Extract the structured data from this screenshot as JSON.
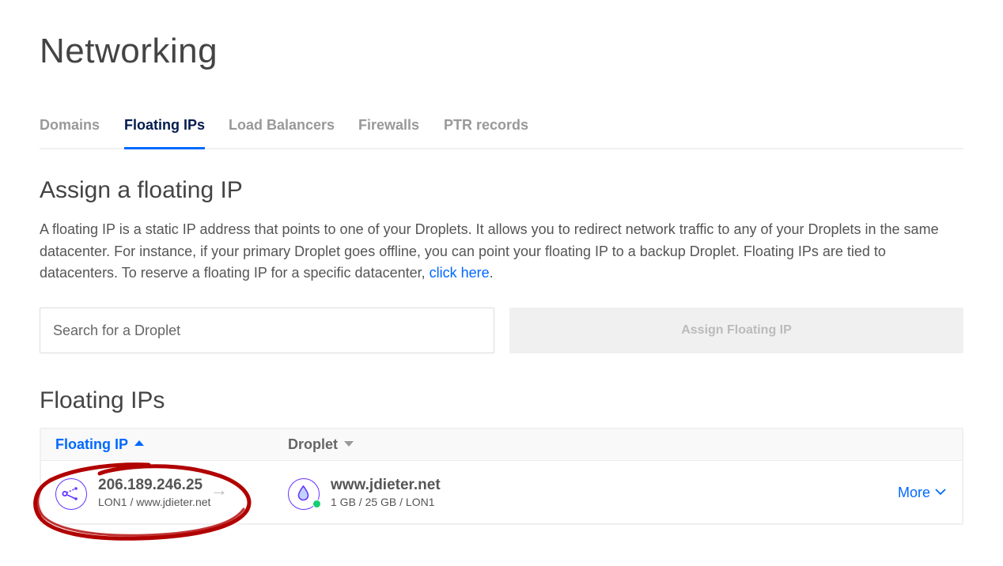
{
  "page": {
    "title": "Networking"
  },
  "tabs": [
    {
      "label": "Domains",
      "active": false
    },
    {
      "label": "Floating IPs",
      "active": true
    },
    {
      "label": "Load Balancers",
      "active": false
    },
    {
      "label": "Firewalls",
      "active": false
    },
    {
      "label": "PTR records",
      "active": false
    }
  ],
  "assign": {
    "title": "Assign a floating IP",
    "description": "A floating IP is a static IP address that points to one of your Droplets. It allows you to redirect network traffic to any of your Droplets in the same datacenter. For instance, if your primary Droplet goes offline, you can point your floating IP to a backup Droplet. Floating IPs are tied to datacenters. To reserve a floating IP for a specific datacenter,",
    "link_text": "click here",
    "link_suffix": ".",
    "search_placeholder": "Search for a Droplet",
    "button_label": "Assign Floating IP"
  },
  "floating_ips": {
    "title": "Floating IPs",
    "columns": [
      {
        "label": "Floating IP",
        "sort": "asc"
      },
      {
        "label": "Droplet",
        "sort": "none"
      }
    ],
    "rows": [
      {
        "ip": "206.189.246.25",
        "ip_sub": "LON1 / www.jdieter.net",
        "droplet_name": "www.jdieter.net",
        "droplet_sub": "1 GB / 25 GB / LON1",
        "droplet_status": "active",
        "action_label": "More"
      }
    ]
  },
  "colors": {
    "accent": "#0069ff",
    "icon_purple": "#6633ff",
    "status_green": "#15cd72",
    "annotation_red": "#b10000"
  },
  "icons": {
    "floating_ip": "floating-ip-icon",
    "droplet": "droplet-icon",
    "arrow": "arrow-right-icon",
    "more": "chevron-down-icon"
  }
}
